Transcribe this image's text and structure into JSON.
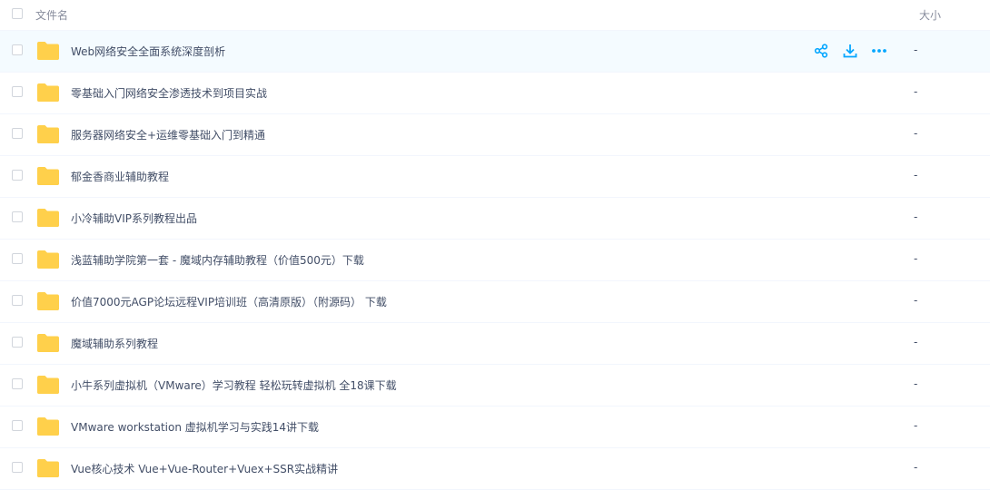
{
  "header": {
    "name_label": "文件名",
    "size_label": "大小"
  },
  "accent_color": "#06a7ff",
  "folder_color": "#ffd04b",
  "files": [
    {
      "name": "Web网络安全全面系统深度剖析",
      "size": "-",
      "hover": true
    },
    {
      "name": "零基础入门网络安全渗透技术到项目实战",
      "size": "-"
    },
    {
      "name": "服务器网络安全+运维零基础入门到精通",
      "size": "-"
    },
    {
      "name": "郁金香商业辅助教程",
      "size": "-"
    },
    {
      "name": "小冷辅助VIP系列教程出品",
      "size": "-"
    },
    {
      "name": "浅蓝辅助学院第一套 - 魔域内存辅助教程（价值500元）下载",
      "size": "-"
    },
    {
      "name": "价值7000元AGP论坛远程VIP培训班（高清原版）（附源码） 下载",
      "size": "-"
    },
    {
      "name": "魔域辅助系列教程",
      "size": "-"
    },
    {
      "name": "小牛系列虚拟机（VMware）学习教程 轻松玩转虚拟机 全18课下载",
      "size": "-"
    },
    {
      "name": "VMware workstation 虚拟机学习与实践14讲下载",
      "size": "-"
    },
    {
      "name": "Vue核心技术 Vue+Vue-Router+Vuex+SSR实战精讲",
      "size": "-"
    }
  ],
  "row_actions": [
    "share-icon",
    "download-icon",
    "more-icon"
  ]
}
